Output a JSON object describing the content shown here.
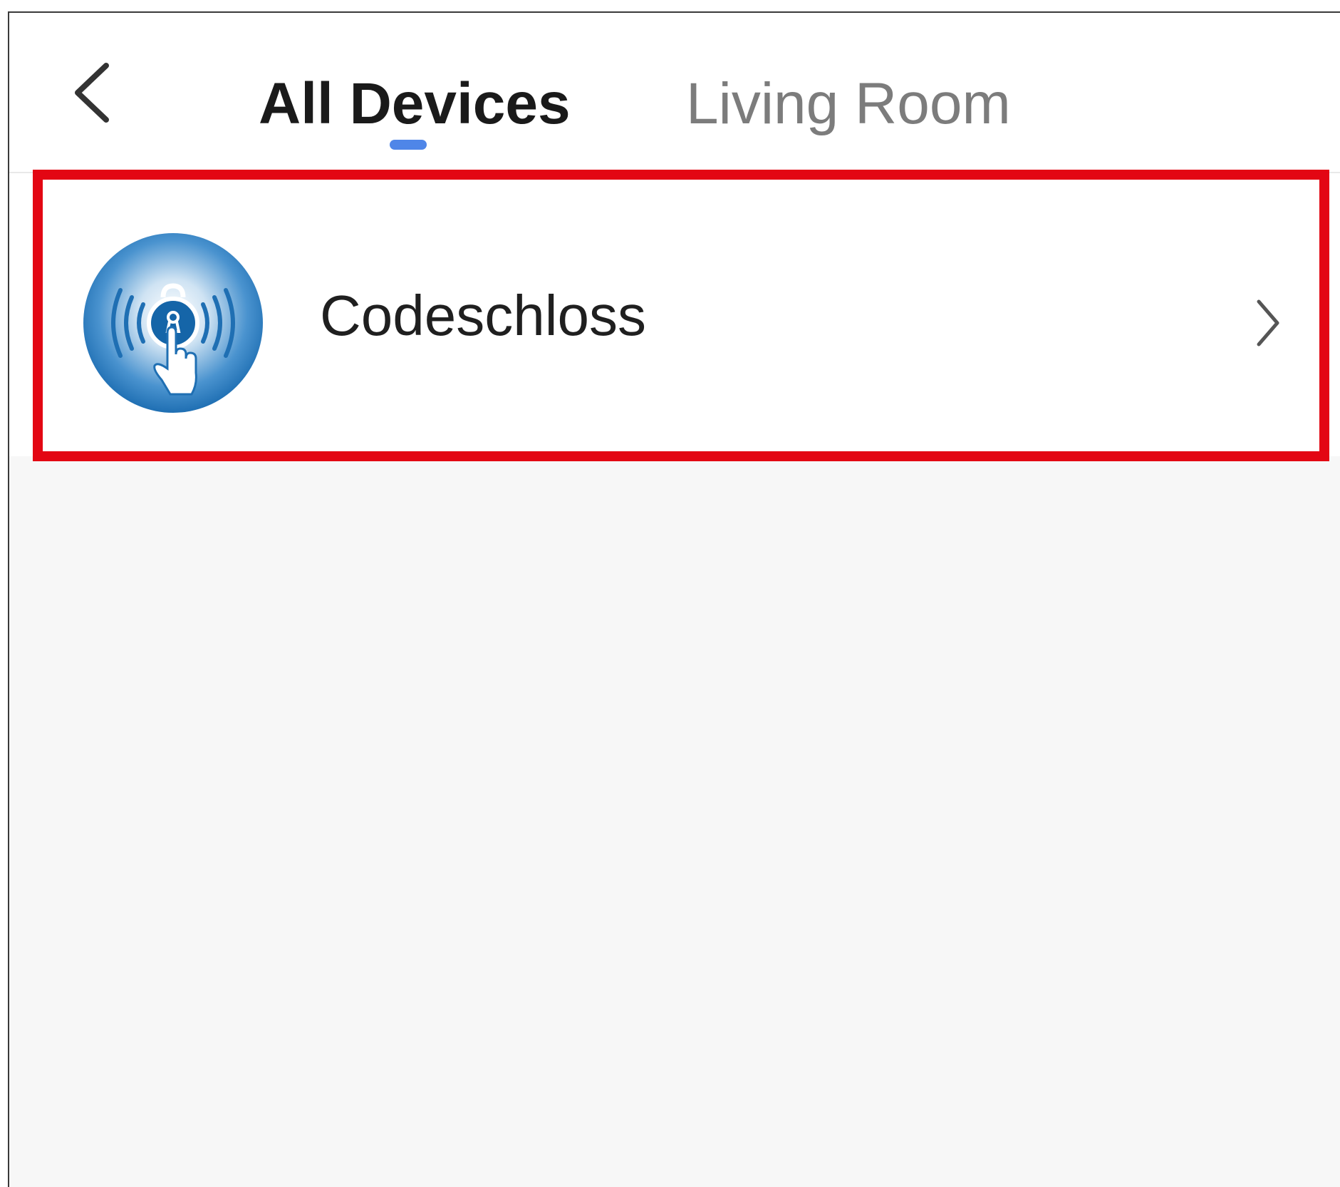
{
  "header": {
    "back_icon": "chevron-left-icon",
    "tabs": [
      {
        "label": "All Devices",
        "active": true
      },
      {
        "label": "Living Room",
        "active": false
      }
    ]
  },
  "devices": [
    {
      "name": "Codeschloss",
      "icon": "code-lock-icon",
      "action_icon": "chevron-right-icon"
    }
  ],
  "colors": {
    "accent": "#4f86e8",
    "highlight": "#e30613",
    "active_tab_text": "#1a1a1a",
    "inactive_tab_text": "#7c7c7c",
    "content_background": "#f7f7f7"
  }
}
